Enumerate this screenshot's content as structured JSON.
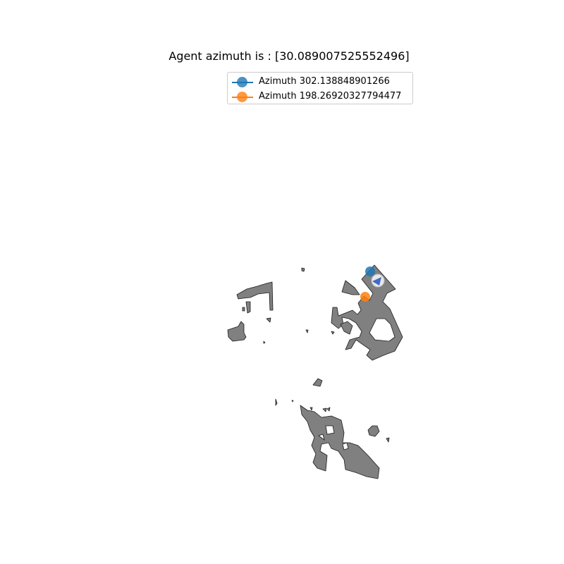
{
  "title": "Agent azimuth is : [30.089007525552496]",
  "legend": [
    {
      "label": "Azimuth 302.138848901266",
      "color": "#1f77b4"
    },
    {
      "label": "Azimuth 198.26920327794477",
      "color": "#ff7f0e"
    }
  ],
  "map": {
    "fill_color": "#808080",
    "stroke_color": "#1a1a1a",
    "agent_marker_color": "#4169c8"
  }
}
